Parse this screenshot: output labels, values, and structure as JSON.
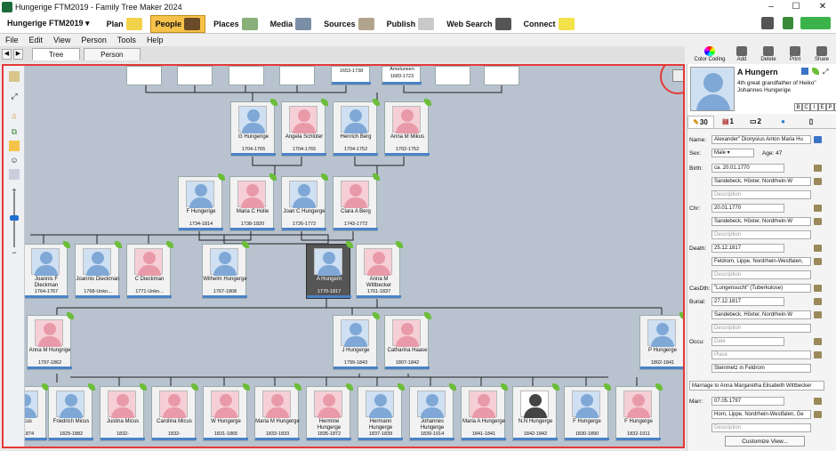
{
  "window": {
    "title": "Hungerige FTM2019 - Family Tree Maker 2024"
  },
  "ribbon": {
    "tree_selector": "Hungerige FTM2019",
    "items": [
      {
        "label": "Plan",
        "icon": "notepad-icon"
      },
      {
        "label": "People",
        "icon": "people-icon",
        "active": true
      },
      {
        "label": "Places",
        "icon": "map-icon"
      },
      {
        "label": "Media",
        "icon": "camera-icon"
      },
      {
        "label": "Sources",
        "icon": "book-icon"
      },
      {
        "label": "Publish",
        "icon": "printer-icon"
      },
      {
        "label": "Web Search",
        "icon": "binoculars-icon"
      },
      {
        "label": "Connect",
        "icon": "sticky-note-icon"
      }
    ]
  },
  "menu": [
    "File",
    "Edit",
    "View",
    "Person",
    "Tools",
    "Help"
  ],
  "tabs": [
    "Tree",
    "Person"
  ],
  "toolbar": [
    "Color Coding",
    "Add",
    "Delete",
    "Print",
    "Share"
  ],
  "tree": {
    "top_row": [
      {
        "name": "",
        "dates": "1653-1738"
      },
      {
        "name": "Amelunxen",
        "dates": "1683-1723"
      }
    ],
    "gen4": [
      {
        "name": "G Hungerige",
        "dates": "1704-1765",
        "sex": "m"
      },
      {
        "name": "Angela Schlüter",
        "dates": "1704-1765",
        "sex": "f"
      },
      {
        "name": "Henrich Berg",
        "dates": "1704-1752",
        "sex": "m"
      },
      {
        "name": "Anna M Mikus",
        "dates": "1702-1752",
        "sex": "f"
      }
    ],
    "gen3": [
      {
        "name": "F Hungerige",
        "dates": "1734-1814",
        "sex": "m"
      },
      {
        "name": "Maria C Holle",
        "dates": "1738-1820",
        "sex": "f"
      },
      {
        "name": "Joan C Hungerge",
        "dates": "1726-1772",
        "sex": "m"
      },
      {
        "name": "Clara A Berg",
        "dates": "1743-1772",
        "sex": "f"
      }
    ],
    "gen2": [
      {
        "name": "Joannis F Dieckman",
        "dates": "1764-1767",
        "sex": "m"
      },
      {
        "name": "Joannis Dieckman",
        "dates": "1768-Unkn...",
        "sex": "m"
      },
      {
        "name": "C Dieckman",
        "dates": "1771-Unkn...",
        "sex": "f"
      },
      {
        "name": "Wilhelm Hungerge",
        "dates": "1767-1808",
        "sex": "m"
      },
      {
        "name": "A Hungern",
        "dates": "1770-1817",
        "sex": "m",
        "selected": true
      },
      {
        "name": "Anna M Wittbecker",
        "dates": "1761-1837",
        "sex": "f"
      }
    ],
    "gen1": [
      {
        "name": "Anna M Hungrige",
        "dates": "1797-1862",
        "sex": "f"
      },
      {
        "name": "J Hungerge",
        "dates": "1799-1843",
        "sex": "m"
      },
      {
        "name": "Catharina Haase",
        "dates": "1807-1842",
        "sex": "f"
      },
      {
        "name": "P Hungerge",
        "dates": "1802-1841",
        "sex": "m"
      }
    ],
    "gen0": [
      {
        "name": "Micus",
        "dates": "27-1874",
        "sex": "m"
      },
      {
        "name": "Friedrich Micus",
        "dates": "1829-1882",
        "sex": "m"
      },
      {
        "name": "Justina Micus",
        "dates": "1832-",
        "sex": "f"
      },
      {
        "name": "Carolina Micus",
        "dates": "1832-",
        "sex": "f"
      },
      {
        "name": "W Hungerge",
        "dates": "1831-1865",
        "sex": "f"
      },
      {
        "name": "Maria M Hungerge",
        "dates": "1833-1833",
        "sex": "f"
      },
      {
        "name": "Hermine Hungerge",
        "dates": "1835-1872",
        "sex": "f"
      },
      {
        "name": "Hermann Hungerge",
        "dates": "1837-1839",
        "sex": "m"
      },
      {
        "name": "Johannes Hungerge",
        "dates": "1839-1914",
        "sex": "m"
      },
      {
        "name": "Maria A Hungerge",
        "dates": "1841-1841",
        "sex": "f"
      },
      {
        "name": "N.N Hungerge",
        "dates": "1842-1842",
        "sex": "u"
      },
      {
        "name": "F Hungerge",
        "dates": "1830-1890",
        "sex": "m"
      },
      {
        "name": "F Hungerge",
        "dates": "1832-1911",
        "sex": "f"
      }
    ]
  },
  "person": {
    "name": "A Hungern",
    "relationship": "4th great grandfather of Heiko\" Johannes Hungerige",
    "letters": [
      "B",
      "C",
      "I",
      "E",
      "P",
      "S"
    ],
    "tabs": [
      "30",
      "1",
      "2",
      "",
      ""
    ],
    "fields": {
      "name_label": "Name:",
      "name": "Alexander\" Dionysius Anton Maria Hu",
      "sex_label": "Sex:",
      "sex": "Male",
      "age": "Age: 47",
      "birth_label": "Birth:",
      "birth_date": "ca. 20.01.1770",
      "birth_place": "Sandebeck, Höxter, Nordrhein-W",
      "chr_label": "Chr:",
      "chr_date": "20.01.1770",
      "chr_place": "Sandebeck, Höxter, Nordrhein-W",
      "death_label": "Death:",
      "death_date": "25.12.1817",
      "death_place": "Feldrom, Lippe, Nordrhein-Westfalen,",
      "casdth_label": "CasDth:",
      "casdth": "\"Lungensucht\" (Tuberkulose)",
      "burial_label": "Burial:",
      "burial_date": "27.12.1817",
      "burial_place": "Sandebeck, Höxter, Nordrhein-W",
      "occu_label": "Occu:",
      "occu": "Steinmetz in Feldrom",
      "marriage": "Marriage to Anna Margaretha Elisabeth Wittbecker",
      "marr_label": "Marr:",
      "marr_date": "07.05.1797",
      "marr_place": "Horn, Lippe, Nordrhein-Westfalen, Ge",
      "desc_placeholder": "Description",
      "date_placeholder": "Date",
      "place_placeholder": "Place"
    },
    "customize": "Customize View..."
  }
}
